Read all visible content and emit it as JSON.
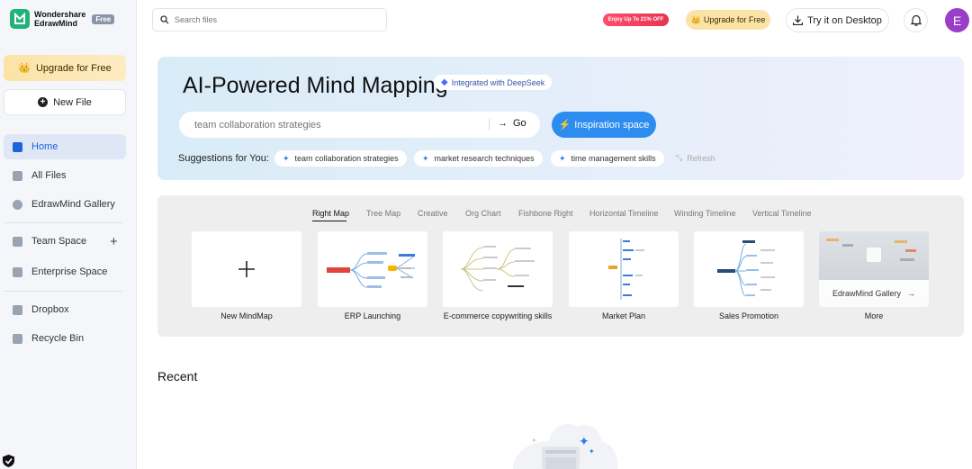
{
  "brand": {
    "line1": "Wondershare",
    "line2": "EdrawMind",
    "badge": "Free"
  },
  "sidebar": {
    "upgrade_label": "Upgrade for Free",
    "new_file_label": "New File",
    "items": [
      {
        "label": "Home",
        "icon": "home-icon",
        "active": true
      },
      {
        "label": "All Files",
        "icon": "file-icon"
      },
      {
        "label": "EdrawMind Gallery",
        "icon": "gallery-icon"
      },
      {
        "label": "Team Space",
        "icon": "team-icon"
      },
      {
        "label": "Enterprise Space",
        "icon": "building-icon"
      },
      {
        "label": "Dropbox",
        "icon": "dropbox-icon"
      },
      {
        "label": "Recycle Bin",
        "icon": "trash-icon"
      }
    ]
  },
  "topbar": {
    "search_placeholder": "Search files",
    "promo": "Enjoy Up To 21% OFF",
    "upgrade_label": "Upgrade for Free",
    "desktop_label": "Try it on Desktop",
    "avatar_initial": "E"
  },
  "hero": {
    "title": "AI-Powered Mind Mapping",
    "badge": "Integrated with DeepSeek",
    "input_placeholder": "team collaboration strategies",
    "go_label": "Go",
    "inspiration_label": "Inspiration space",
    "suggestions_label": "Suggestions for You:",
    "suggestions": [
      "team collaboration strategies",
      "market research techniques",
      "time management skills"
    ],
    "refresh_label": "Refresh"
  },
  "templates": {
    "tabs": [
      "Right Map",
      "Tree Map",
      "Creative",
      "Org Chart",
      "Fishbone Right",
      "Horizontal Timeline",
      "Winding Timeline",
      "Vertical Timeline"
    ],
    "cards": [
      "New MindMap",
      "ERP Launching",
      "E-commerce copywriting skills",
      "Market Plan",
      "Sales Promotion",
      "More"
    ],
    "gallery_overlay": "EdrawMind Gallery"
  },
  "recent": {
    "title": "Recent"
  },
  "colors": {
    "accent": "#2d8cf0",
    "active_nav": "#1d63d8",
    "brand": "#21b27a",
    "promo": "#e8344f",
    "avatar": "#9a3ec7"
  }
}
